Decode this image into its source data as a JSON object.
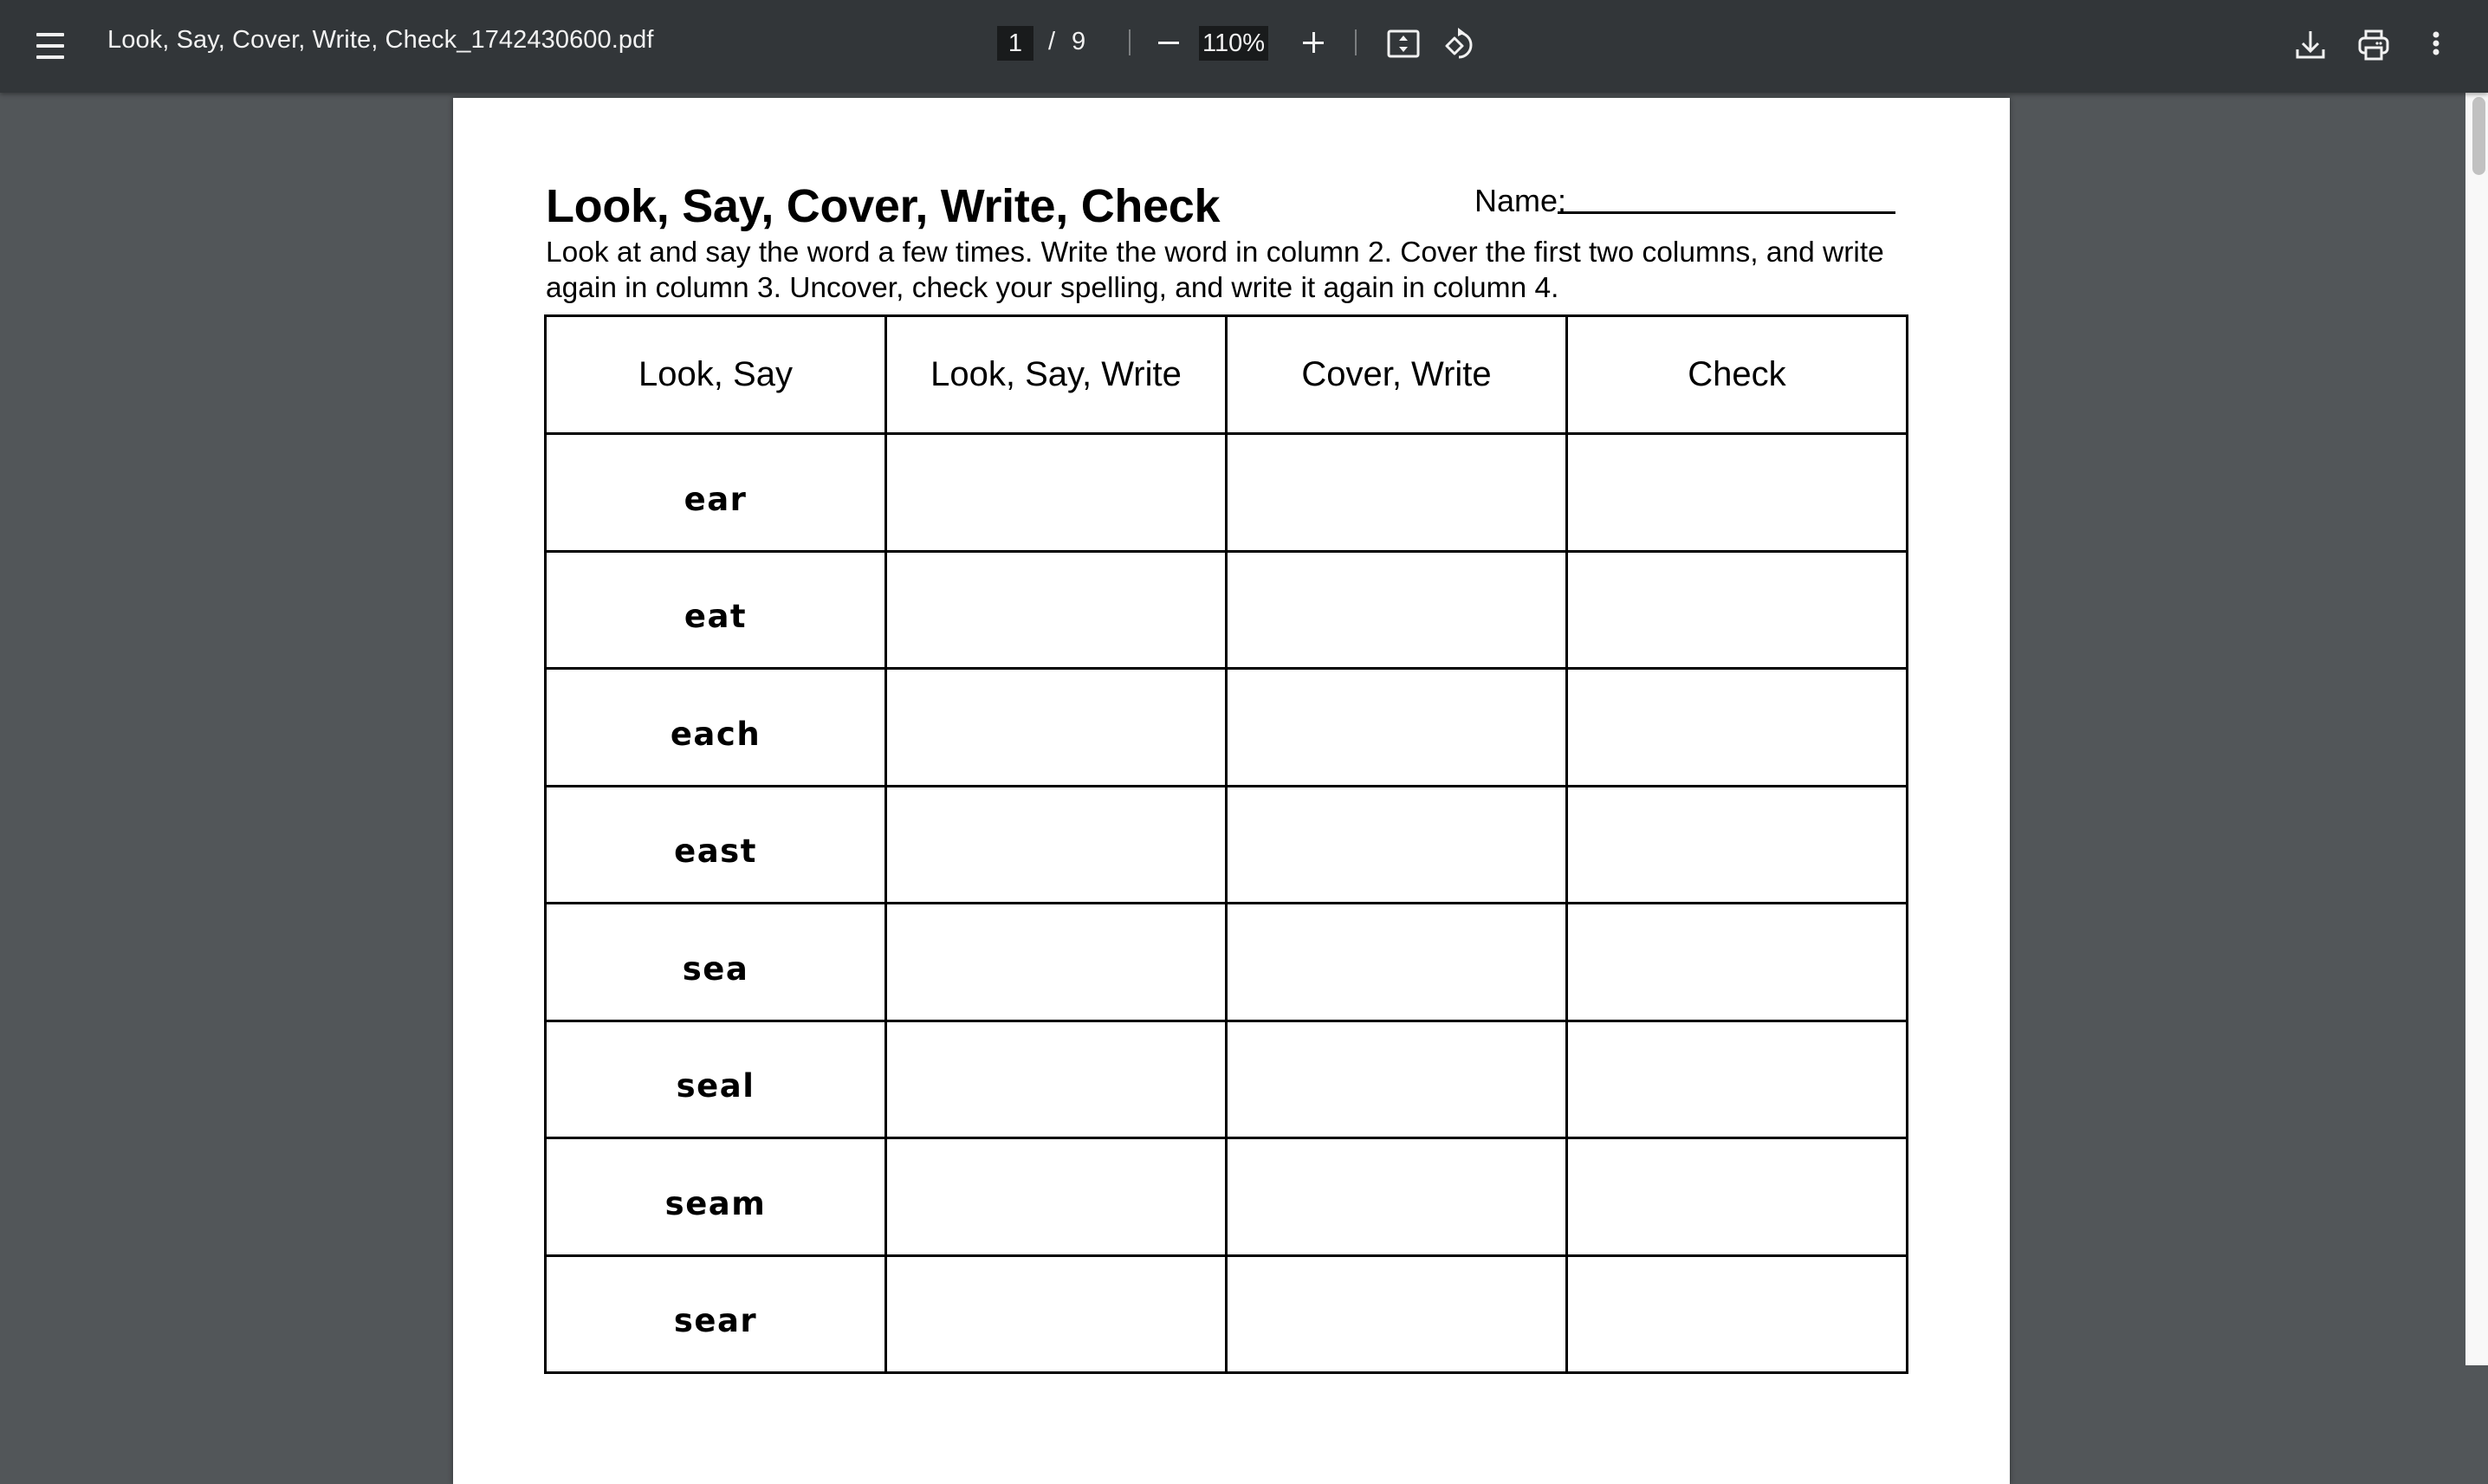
{
  "viewer": {
    "file_name": "Look, Say, Cover, Write, Check_1742430600.pdf",
    "current_page": "1",
    "page_separator": "/",
    "total_pages": "9",
    "zoom": "110%",
    "icons": {
      "menu": "hamburger-menu-icon",
      "zoom_out": "minus-icon",
      "zoom_in": "plus-icon",
      "fit": "fit-to-page-icon",
      "rotate": "rotate-counterclockwise-icon",
      "download": "download-icon",
      "print": "print-icon",
      "more": "more-vertical-icon"
    }
  },
  "document": {
    "title": "Look, Say, Cover, Write, Check",
    "name_label": "Name:",
    "instructions": "Look at and say the word a few times. Write the word in column 2. Cover the first two columns, and write again in column 3. Uncover, check your spelling, and write it again in column 4.",
    "table": {
      "headers": [
        "Look, Say",
        "Look, Say, Write",
        "Cover, Write",
        "Check"
      ],
      "words": [
        "ear",
        "eat",
        "each",
        "east",
        "sea",
        "seal",
        "seam",
        "sear"
      ]
    }
  }
}
